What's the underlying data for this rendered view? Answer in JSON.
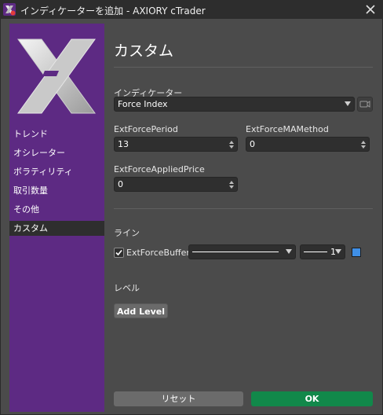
{
  "window": {
    "title": "インディケーターを追加 - AXIORY cTrader"
  },
  "sidebar": {
    "items": [
      {
        "label": "トレンド",
        "active": false
      },
      {
        "label": "オシレーター",
        "active": false
      },
      {
        "label": "ボラティリティ",
        "active": false
      },
      {
        "label": "取引数量",
        "active": false
      },
      {
        "label": "その他",
        "active": false
      },
      {
        "label": "カスタム",
        "active": true
      }
    ]
  },
  "main": {
    "title": "カスタム",
    "indicator": {
      "label": "インディケーター",
      "value": "Force Index"
    },
    "params": {
      "period": {
        "label": "ExtForcePeriod",
        "value": "13"
      },
      "ma_method": {
        "label": "ExtForceMAMethod",
        "value": "0"
      },
      "applied_price": {
        "label": "ExtForceAppliedPrice",
        "value": "0"
      }
    },
    "lines": {
      "label": "ライン",
      "buffer": {
        "name": "ExtForceBuffer",
        "checked": true,
        "thickness": "1",
        "color": "#3f8fe6"
      }
    },
    "levels": {
      "label": "レベル",
      "add_button": "Add Level"
    }
  },
  "footer": {
    "reset_label": "リセット",
    "ok_label": "OK"
  },
  "colors": {
    "sidebar": "#5d2a83",
    "ok_button": "#11884a"
  }
}
